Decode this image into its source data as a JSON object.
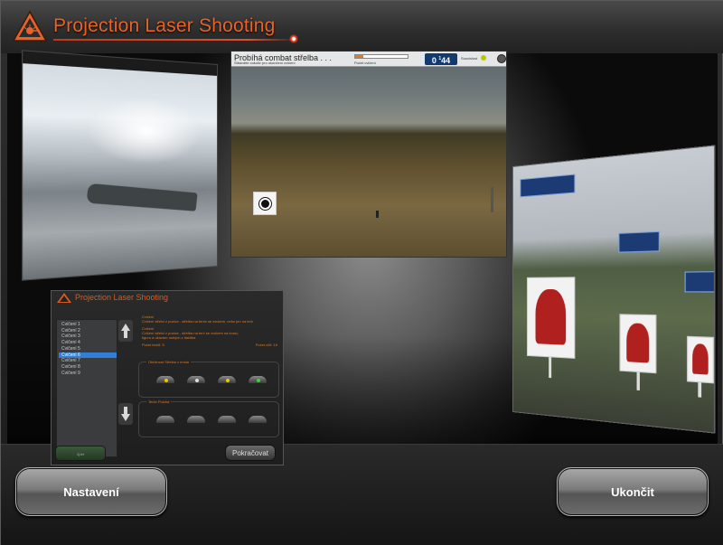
{
  "header": {
    "title": "Projection Laser Shooting",
    "logo": "laser-warning-triangle-icon"
  },
  "previews": {
    "center": {
      "title": "Probíhá combat střelba . . .",
      "subtitle": "Stiskněte cokoliv pro ukončení cvičení",
      "progress_label": "Počet cvičení",
      "progress": 0.15,
      "score_main": "0",
      "score_sup": "1",
      "score_tail": "44",
      "status_label": "Souvislost"
    },
    "menu": {
      "title": "Projection Laser Shooting",
      "exercises": [
        "Cvičení 1",
        "Cvičení 2",
        "Cvičení 3",
        "Cvičení 4",
        "Cvičení 5",
        "Cvičení 6",
        "Cvičení 7",
        "Cvičení 8",
        "Cvičení 9"
      ],
      "selected_index": 5,
      "desc_lines": [
        "Cvičení",
        "Cvičení střelci z pozice - střelba na terče se zvukem, nebo jen na terč",
        "Cvičení",
        "Cvičení střelci z pozice - střelba na terč se zvukem na konci, ",
        "figuru a ukázání ostrých z tlačítka"
      ],
      "stat_left": "Počet terčů:    5",
      "stat_right": "Počet cílů:    15",
      "group1_label": "Obtížnost    Střelba z místa",
      "group2_label": "Terče    Poloha",
      "continue_label": "Pokračovat",
      "back_label": "Zpět"
    }
  },
  "buttons": {
    "settings": "Nastavení",
    "quit": "Ukončit"
  },
  "colors": {
    "accent": "#e8622a",
    "laser_red": "#ff3b1a",
    "selection_blue": "#2f7fd8",
    "score_panel": "#133a6e"
  }
}
